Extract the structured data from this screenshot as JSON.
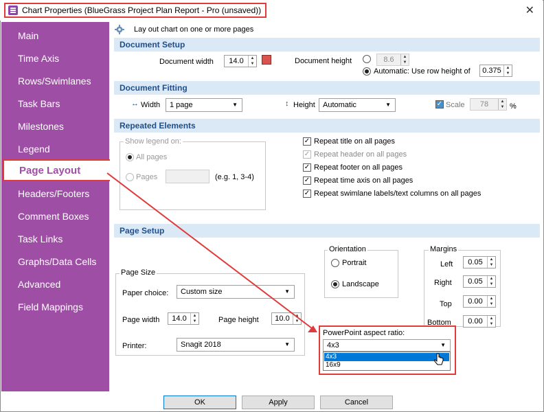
{
  "window": {
    "title": "Chart Properties (BlueGrass Project Plan Report - Pro (unsaved))",
    "close": "✕"
  },
  "sidebar": {
    "items": [
      "Main",
      "Time Axis",
      "Rows/Swimlanes",
      "Task Bars",
      "Milestones",
      "Legend",
      "Page Layout",
      "Headers/Footers",
      "Comment Boxes",
      "Task Links",
      "Graphs/Data Cells",
      "Advanced",
      "Field Mappings"
    ],
    "active": "Page Layout"
  },
  "header_hint": "Lay out chart on one or more pages",
  "document_setup": {
    "title": "Document Setup",
    "width_label": "Document width",
    "width_value": "14.0",
    "height_label": "Document height",
    "height_value": "8.6",
    "auto_label": "Automatic: Use row height of",
    "auto_value": "0.375"
  },
  "document_fitting": {
    "title": "Document Fitting",
    "width_label": "Width",
    "width_value": "1 page",
    "height_label": "Height",
    "height_value": "Automatic",
    "scale_label": "Scale",
    "scale_value": "78",
    "scale_unit": "%"
  },
  "repeated": {
    "title": "Repeated Elements",
    "show_legend_on": "Show legend on:",
    "all_pages": "All pages",
    "pages": "Pages",
    "pages_hint": "(e.g. 1, 3-4)",
    "checks": [
      {
        "label": "Repeat title on all pages",
        "checked": true,
        "disabled": false
      },
      {
        "label": "Repeat header on all pages",
        "checked": true,
        "disabled": true
      },
      {
        "label": "Repeat footer on all pages",
        "checked": true,
        "disabled": false
      },
      {
        "label": "Repeat time axis on all pages",
        "checked": true,
        "disabled": false
      },
      {
        "label": "Repeat swimlane labels/text columns on all pages",
        "checked": true,
        "disabled": false
      }
    ]
  },
  "page_setup": {
    "title": "Page Setup",
    "page_size": "Page Size",
    "paper_choice_label": "Paper choice:",
    "paper_choice_value": "Custom size",
    "page_width_label": "Page width",
    "page_width_value": "14.0",
    "page_height_label": "Page height",
    "page_height_value": "10.0",
    "printer_label": "Printer:",
    "printer_value": "Snagit 2018",
    "orientation": "Orientation",
    "portrait": "Portrait",
    "landscape": "Landscape",
    "margins": "Margins",
    "left_label": "Left",
    "left_value": "0.05",
    "right_label": "Right",
    "right_value": "0.05",
    "top_label": "Top",
    "top_value": "0.00",
    "bottom_label": "Bottom",
    "bottom_value": "0.00",
    "ppt_label": "PowerPoint aspect ratio:",
    "ppt_value": "4x3",
    "ppt_options": [
      "4x3",
      "16x9"
    ]
  },
  "buttons": {
    "ok": "OK",
    "apply": "Apply",
    "cancel": "Cancel"
  },
  "colors": {
    "sidebar": "#9e4fa5",
    "section": "#dbe9f6",
    "highlight": "#e03a3a",
    "accent": "#0078d7"
  }
}
